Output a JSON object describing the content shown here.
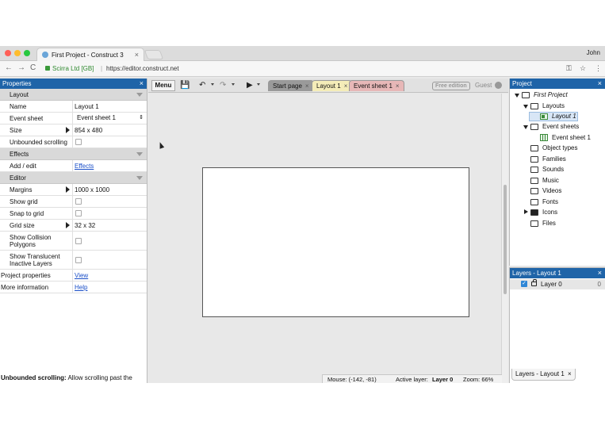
{
  "browser": {
    "tab_title": "First Project - Construct 3",
    "tab_close": "×",
    "user_name": "John",
    "secure_label": "Scirra Ltd [GB]",
    "separator": "|",
    "url": "https://editor.construct.net",
    "nav": {
      "back": "←",
      "forward": "→",
      "reload": "C"
    },
    "right_icons": {
      "key": "⚿",
      "star": "☆",
      "more": "⋮"
    },
    "traffic_colors": [
      "#ff5f57",
      "#febc2e",
      "#28c840"
    ]
  },
  "properties": {
    "title": "Properties",
    "close": "×",
    "sections": {
      "layout": "Layout",
      "effects": "Effects",
      "editor": "Editor"
    },
    "rows": {
      "name": {
        "label": "Name",
        "value": "Layout 1"
      },
      "event_sheet": {
        "label": "Event sheet",
        "value": "Event sheet 1",
        "updown": "⇕"
      },
      "size": {
        "label": "Size",
        "value": "854 x 480"
      },
      "unbounded": {
        "label": "Unbounded scrolling"
      },
      "add_edit": {
        "label": "Add / edit",
        "link": "Effects"
      },
      "margins": {
        "label": "Margins",
        "value": "1000 x 1000"
      },
      "show_grid": {
        "label": "Show grid"
      },
      "snap_grid": {
        "label": "Snap to grid"
      },
      "grid_size": {
        "label": "Grid size",
        "value": "32 x 32"
      },
      "collision": {
        "label_1": "Show Collision",
        "label_2": "Polygons"
      },
      "translucent": {
        "label_1": "Show Translucent",
        "label_2": "Inactive Layers"
      },
      "project_props": {
        "label": "Project properties",
        "link": "View"
      },
      "more_info": {
        "label": "More information",
        "link": "Help"
      }
    },
    "status_bold": "Unbounded scrolling:",
    "status_text": " Allow scrolling past the"
  },
  "toolbar": {
    "menu_label": "Menu",
    "save_icon": "💾",
    "undo_icon": "↶",
    "redo_icon": "↷",
    "play_icon": "▶",
    "tabs": [
      {
        "label": "Start page",
        "close": "×",
        "color": "#9a9a9a"
      },
      {
        "label": "Layout 1",
        "close": "×",
        "color": "#f4ecb8"
      },
      {
        "label": "Event sheet 1",
        "close": "×",
        "color": "#e7b7b7"
      }
    ],
    "free_badge": "Free edition",
    "guest_label": "Guest"
  },
  "status": {
    "mouse": "Mouse: (-142, -81)",
    "active_layer_label": "Active layer:",
    "active_layer_value": "Layer 0",
    "zoom": "Zoom: 66%"
  },
  "project": {
    "title": "Project",
    "close": "×",
    "root": "First Project",
    "layouts": "Layouts",
    "layout_item": "Layout 1",
    "event_sheets": "Event sheets",
    "event_item": "Event sheet 1",
    "folders": [
      "Object types",
      "Families",
      "Sounds",
      "Music",
      "Videos",
      "Fonts",
      "Icons",
      "Files"
    ]
  },
  "layers": {
    "title": "Layers - Layout 1",
    "close": "×",
    "layer_name": "Layer 0",
    "layer_count": "0",
    "check": "✓",
    "bottom_tab": "Layers - Layout 1",
    "bottom_tab_close": "×"
  }
}
